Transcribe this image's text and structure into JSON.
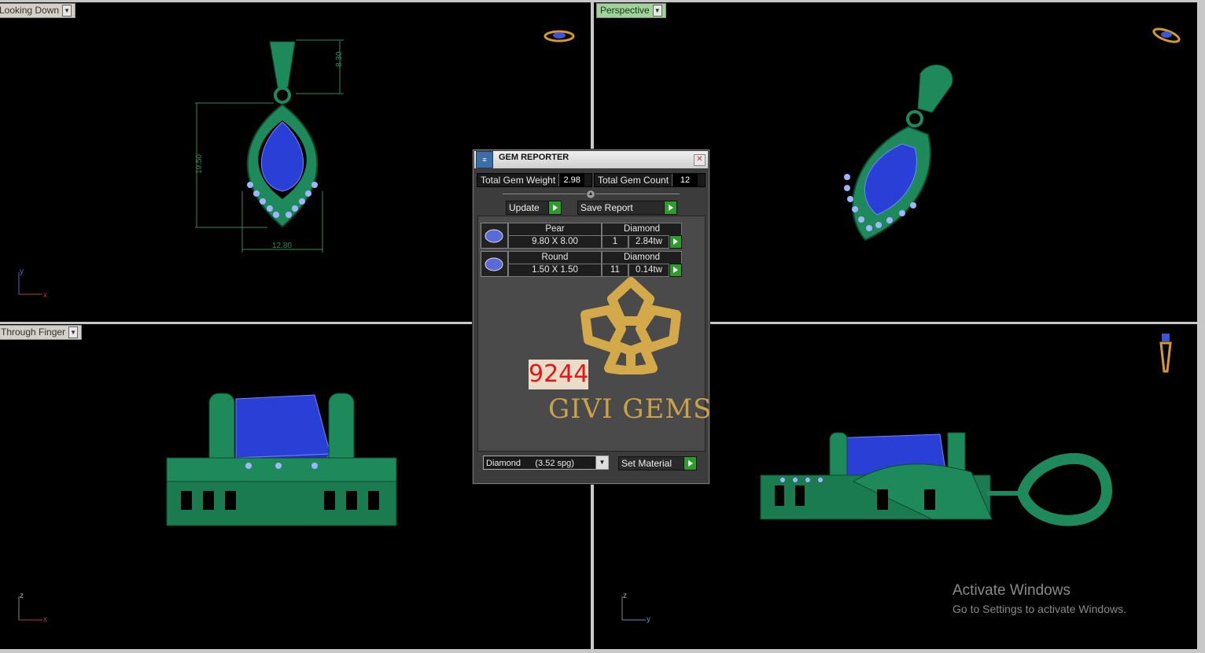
{
  "viewports": {
    "top": {
      "label": "Looking Down",
      "dims": {
        "height": "8.30",
        "length": "19.50",
        "width": "12.80"
      },
      "axes": {
        "v": "y",
        "h": "x"
      }
    },
    "perspective": {
      "label": "Perspective"
    },
    "front": {
      "label": "Through Finger",
      "axes": {
        "v": "z",
        "h": "x"
      }
    },
    "right": {
      "label": "",
      "axes": {
        "v": "z",
        "h": "y"
      }
    }
  },
  "gem_reporter": {
    "title": "GEM REPORTER",
    "total_gem_weight_label": "Total Gem Weight",
    "total_gem_weight": "2.98",
    "total_gem_count_label": "Total Gem Count",
    "total_gem_count": "12",
    "update_label": "Update",
    "save_report_label": "Save Report",
    "gems": [
      {
        "shape": "Pear",
        "material": "Diamond",
        "size": "9.80 X 8.00",
        "count": "1",
        "weight": "2.84tw"
      },
      {
        "shape": "Round",
        "material": "Diamond",
        "size": "1.50 X 1.50",
        "count": "11",
        "weight": "0.14tw"
      }
    ],
    "material_select": "Diamond      (3.52 spg)",
    "set_material_label": "Set Material"
  },
  "watermark": {
    "number": "9244",
    "brand": "GIVI GEMS"
  },
  "activate_windows": {
    "line1": "Activate Windows",
    "line2": "Go to Settings to activate Windows."
  },
  "colors": {
    "metal": "#1e8a5c",
    "gem": "#2a3fd6",
    "accent_gold": "#c9a24a",
    "viewport_bg": "#000000"
  }
}
